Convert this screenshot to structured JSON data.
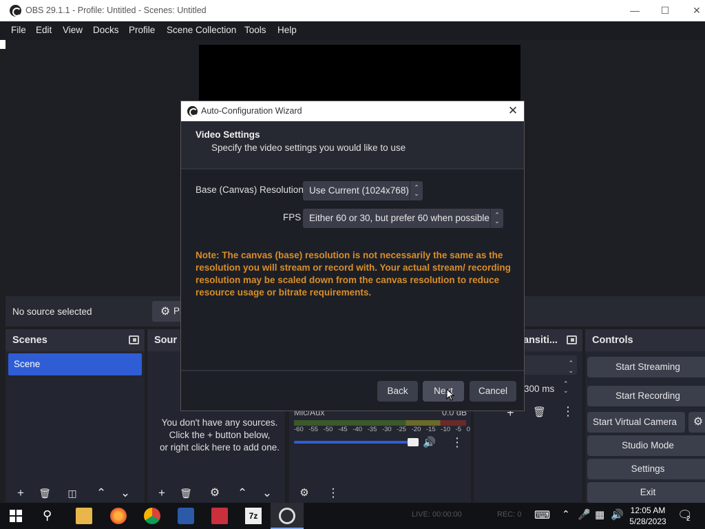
{
  "window": {
    "title": "OBS 29.1.1 - Profile: Untitled - Scenes: Untitled"
  },
  "menu": [
    "File",
    "Edit",
    "View",
    "Docks",
    "Profile",
    "Scene Collection",
    "Tools",
    "Help"
  ],
  "context": {
    "no_source": "No source selected",
    "properties_label": "Pr"
  },
  "docks": {
    "scenes": {
      "title": "Scenes",
      "items": [
        "Scene"
      ]
    },
    "sources": {
      "title": "Sour",
      "empty_text_1": "You don't have any sources.",
      "empty_text_2": "Click the + button below,",
      "empty_text_3": "or right click here to add one."
    },
    "mixer": {
      "channel": "Mic/Aux",
      "level": "0.0 dB",
      "ticks": [
        "-60",
        "-55",
        "-50",
        "-45",
        "-40",
        "-35",
        "-30",
        "-25",
        "-20",
        "-15",
        "-10",
        "-5",
        "0"
      ]
    },
    "transitions": {
      "title": "ansiti...",
      "duration": "300 ms"
    },
    "controls": {
      "title": "Controls",
      "start_streaming": "Start Streaming",
      "start_recording": "Start Recording",
      "start_virtual_camera": "Start Virtual Camera",
      "studio_mode": "Studio Mode",
      "settings": "Settings",
      "exit": "Exit"
    }
  },
  "wizard": {
    "title": "Auto-Configuration Wizard",
    "heading": "Video Settings",
    "subheading": "Specify the video settings you would like to use",
    "resolution_label": "Base (Canvas) Resolution",
    "resolution_value": "Use Current (1024x768)",
    "fps_label": "FPS",
    "fps_value": "Either 60 or 30, but prefer 60 when possible",
    "note": "Note: The canvas (base) resolution is not necessarily the same as the resolution you will stream or record with. Your actual stream/ recording resolution may be scaled down from the canvas resolution to reduce resource usage or bitrate requirements.",
    "back": "Back",
    "next": "Next",
    "cancel": "Cancel"
  },
  "statusbar": {
    "live": "LIVE: 00:00:00",
    "rec": "REC: 0"
  },
  "taskbar": {
    "time": "12:05 AM",
    "date": "5/28/2023",
    "notifications": "2"
  },
  "colors": {
    "accent": "#2f5dd6",
    "note": "#d98e29"
  }
}
